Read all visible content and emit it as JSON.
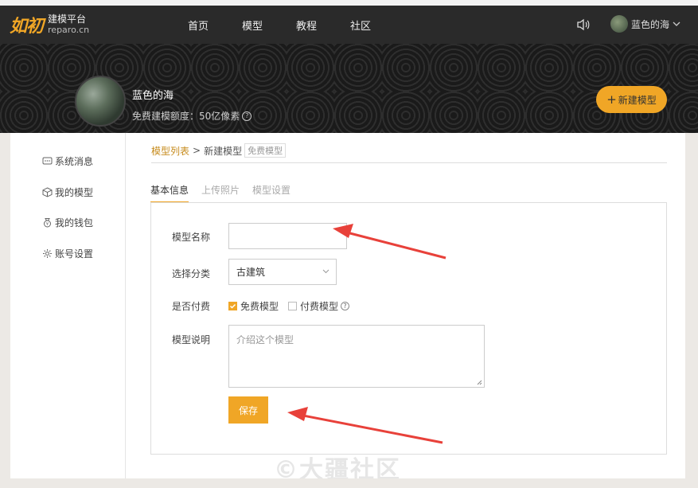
{
  "header": {
    "logo_mark": "如初",
    "logo_title": "建模平台",
    "logo_sub": "reparo.cn",
    "nav": [
      "首页",
      "模型",
      "教程",
      "社区"
    ],
    "user_name": "蓝色的海"
  },
  "profile": {
    "name": "蓝色的海",
    "quota": "免费建模额度：50亿像素",
    "new_model_label": "新建模型"
  },
  "sidebar": {
    "items": [
      {
        "label": "系统消息",
        "icon": "message-icon"
      },
      {
        "label": "我的模型",
        "icon": "cube-icon"
      },
      {
        "label": "我的钱包",
        "icon": "wallet-icon"
      },
      {
        "label": "账号设置",
        "icon": "gear-icon"
      }
    ]
  },
  "breadcrumb": {
    "list": "模型列表",
    "separator": ">",
    "current": "新建模型",
    "tag": "免费模型"
  },
  "tabs": [
    "基本信息",
    "上传照片",
    "模型设置"
  ],
  "form": {
    "name_label": "模型名称",
    "name_value": "",
    "category_label": "选择分类",
    "category_value": "古建筑",
    "pay_label": "是否付费",
    "free_option": "免费模型",
    "paid_option": "付费模型",
    "desc_label": "模型说明",
    "desc_placeholder": "介绍这个模型",
    "save_label": "保存"
  },
  "watermark": "©大疆社区",
  "colors": {
    "accent": "#f0a626",
    "topbar": "#2a2a2a",
    "annotation_arrow": "#e8413a"
  }
}
